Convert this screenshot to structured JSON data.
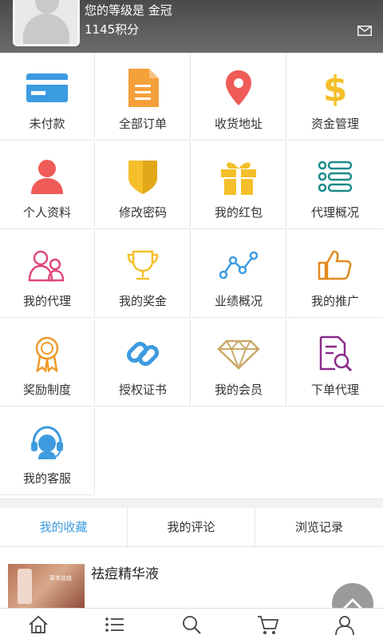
{
  "header": {
    "level_text": "您的等级是 金冠",
    "points_text": "1145积分"
  },
  "grid": [
    {
      "label": "未付款",
      "icon": "credit-card-icon"
    },
    {
      "label": "全部订单",
      "icon": "document-icon"
    },
    {
      "label": "收货地址",
      "icon": "location-pin-icon"
    },
    {
      "label": "资金管理",
      "icon": "dollar-icon"
    },
    {
      "label": "个人资料",
      "icon": "person-icon"
    },
    {
      "label": "修改密码",
      "icon": "shield-icon"
    },
    {
      "label": "我的红包",
      "icon": "gift-icon"
    },
    {
      "label": "代理概况",
      "icon": "list-icon"
    },
    {
      "label": "我的代理",
      "icon": "group-icon"
    },
    {
      "label": "我的奖金",
      "icon": "trophy-icon"
    },
    {
      "label": "业绩概况",
      "icon": "line-chart-icon"
    },
    {
      "label": "我的推广",
      "icon": "thumbs-up-icon"
    },
    {
      "label": "奖励制度",
      "icon": "award-ribbon-icon"
    },
    {
      "label": "授权证书",
      "icon": "link-icon"
    },
    {
      "label": "我的会员",
      "icon": "diamond-icon"
    },
    {
      "label": "下单代理",
      "icon": "document-search-icon"
    },
    {
      "label": "我的客服",
      "icon": "headset-icon"
    }
  ],
  "tabs": [
    {
      "label": "我的收藏",
      "active": true
    },
    {
      "label": "我的评论",
      "active": false
    },
    {
      "label": "浏览记录",
      "active": false
    }
  ],
  "product": {
    "title": "祛痘精华液",
    "image_text": "草本祛痘"
  },
  "bottom_nav": [
    "home-icon",
    "list-menu-icon",
    "search-icon",
    "cart-icon",
    "user-icon"
  ],
  "colors": {
    "accent": "#3e9be0",
    "card_blue": "#3b9be0",
    "doc_orange": "#f5a03a",
    "pin_red": "#ef5b56",
    "dollar_yellow": "#f4bf2a",
    "person_red": "#ef5b56",
    "shield_yellow": "#f4bf2a",
    "gift_yellow": "#f4bf2a",
    "list_teal": "#1b8a8a",
    "group_pink": "#e0487a",
    "trophy_yellow": "#f4bf2a",
    "chart_blue": "#3e9be0",
    "thumb_orange": "#e08a1e",
    "award_orange": "#f09a2a",
    "link_blue": "#3e9be0",
    "diamond_gold": "#c9a96a",
    "docsearch_purple": "#8a2a8a",
    "headset_blue": "#3e9be0"
  }
}
